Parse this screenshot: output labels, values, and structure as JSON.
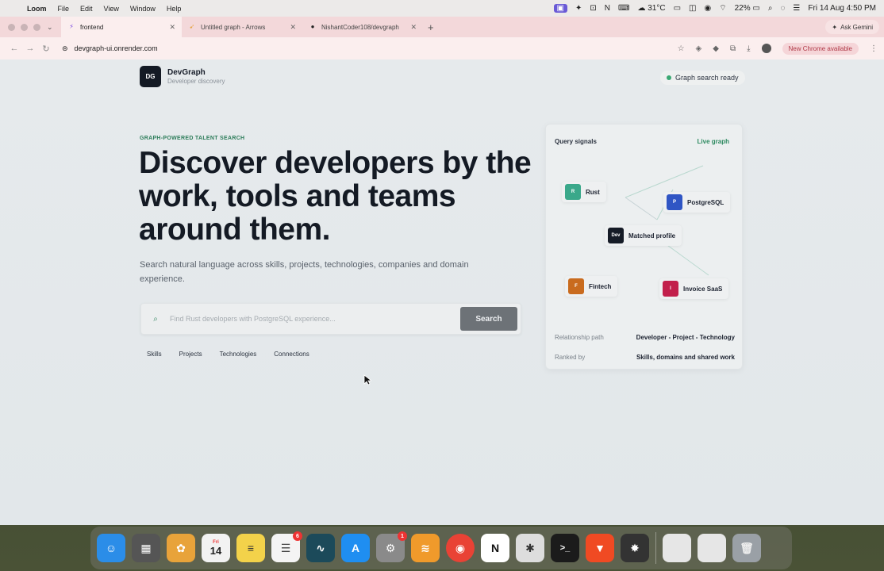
{
  "menubar": {
    "app_name": "Loom",
    "items": [
      "File",
      "Edit",
      "View",
      "Window",
      "Help"
    ],
    "temperature": "31°C",
    "battery": "22%",
    "datetime": "Fri 14 Aug  4:50 PM"
  },
  "tabs": [
    {
      "title": "frontend",
      "icon_color": "#7b4ae0"
    },
    {
      "title": "Untitled graph - Arrows",
      "icon_color": "#e6a545"
    },
    {
      "title": "NishantCoder108/devgraph",
      "icon_color": "#222222"
    }
  ],
  "ask_gemini": "Ask Gemini",
  "address_bar": {
    "url": "devgraph-ui.onrender.com",
    "new_chrome_label": "New Chrome available"
  },
  "brand": {
    "logo_text": "DG",
    "name": "DevGraph",
    "tagline": "Developer discovery"
  },
  "status": {
    "label": "Graph search ready",
    "color": "#3aa873"
  },
  "hero": {
    "eyebrow": "GRAPH-POWERED TALENT SEARCH",
    "headline": "Discover developers by the work, tools and teams around them.",
    "subline": "Search natural language across skills, projects, technologies, companies and domain experience."
  },
  "search": {
    "placeholder": "Find Rust developers with PostgreSQL experience...",
    "button_label": "Search"
  },
  "filters": [
    "Skills",
    "Projects",
    "Technologies",
    "Connections"
  ],
  "card": {
    "title": "Query signals",
    "link": "Live graph",
    "nodes": [
      {
        "letter": "R",
        "label": "Rust",
        "color": "#3aa88a"
      },
      {
        "letter": "P",
        "label": "PostgreSQL",
        "color": "#2f55c4"
      },
      {
        "letter": "Dev",
        "label": "Matched profile",
        "color": "#151b26"
      },
      {
        "letter": "F",
        "label": "Fintech",
        "color": "#c96b1e"
      },
      {
        "letter": "I",
        "label": "Invoice SaaS",
        "color": "#c21f4b"
      }
    ],
    "rows": [
      {
        "key": "Relationship path",
        "value": "Developer - Project - Technology"
      },
      {
        "key": "Ranked by",
        "value": "Skills, domains and shared work"
      }
    ]
  },
  "dock": {
    "calendar_day": "14",
    "calendar_month": "Fri",
    "reminders_badge": "6",
    "settings_badge": "1",
    "apps": [
      {
        "name": "finder",
        "color": "#2b8de8",
        "glyph": "☺"
      },
      {
        "name": "launchpad",
        "color": "#555555",
        "glyph": "▦"
      },
      {
        "name": "photos",
        "color": "#e8a33a",
        "glyph": "✿"
      },
      {
        "name": "calendar",
        "color": "#f2f2f2",
        "glyph": ""
      },
      {
        "name": "notes",
        "color": "#f3d24a",
        "glyph": "≡"
      },
      {
        "name": "reminders",
        "color": "#f4f4f4",
        "glyph": "☰"
      },
      {
        "name": "activity-monitor",
        "color": "#1c4a5a",
        "glyph": "∿"
      },
      {
        "name": "app-store",
        "color": "#1f8ef1",
        "glyph": "A"
      },
      {
        "name": "system-settings",
        "color": "#8a8a8a",
        "glyph": "⚙"
      },
      {
        "name": "audible",
        "color": "#f09a2b",
        "glyph": "≋"
      },
      {
        "name": "chrome",
        "color": "#e94235",
        "glyph": "◉"
      },
      {
        "name": "notion",
        "color": "#ffffff",
        "glyph": "N"
      },
      {
        "name": "cloud-app",
        "color": "#dddddd",
        "glyph": "✱"
      },
      {
        "name": "terminal",
        "color": "#1b1b1b",
        "glyph": ">_"
      },
      {
        "name": "brave",
        "color": "#f04a23",
        "glyph": "▼"
      },
      {
        "name": "compressor",
        "color": "#333333",
        "glyph": "✸"
      }
    ]
  }
}
